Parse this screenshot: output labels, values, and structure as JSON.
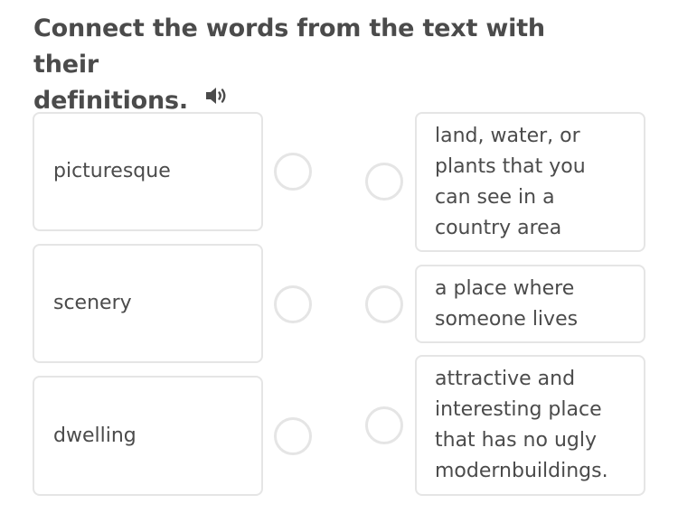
{
  "instruction": {
    "line1": "Connect the words from the text with their",
    "line2": "definitions."
  },
  "icons": {
    "audio": "speaker-icon"
  },
  "words": [
    {
      "label": "picturesque"
    },
    {
      "label": "scenery"
    },
    {
      "label": "dwelling"
    }
  ],
  "definitions": [
    {
      "lines": [
        "land, water, or",
        "plants that you",
        "can see in a",
        "country area"
      ]
    },
    {
      "lines": [
        "a place where",
        "someone lives"
      ]
    },
    {
      "lines": [
        "attractive and",
        "interesting place",
        "that has no ugly",
        "modernbuildings."
      ]
    }
  ],
  "colors": {
    "text": "#4b4b4b",
    "border": "#e5e5e5"
  }
}
